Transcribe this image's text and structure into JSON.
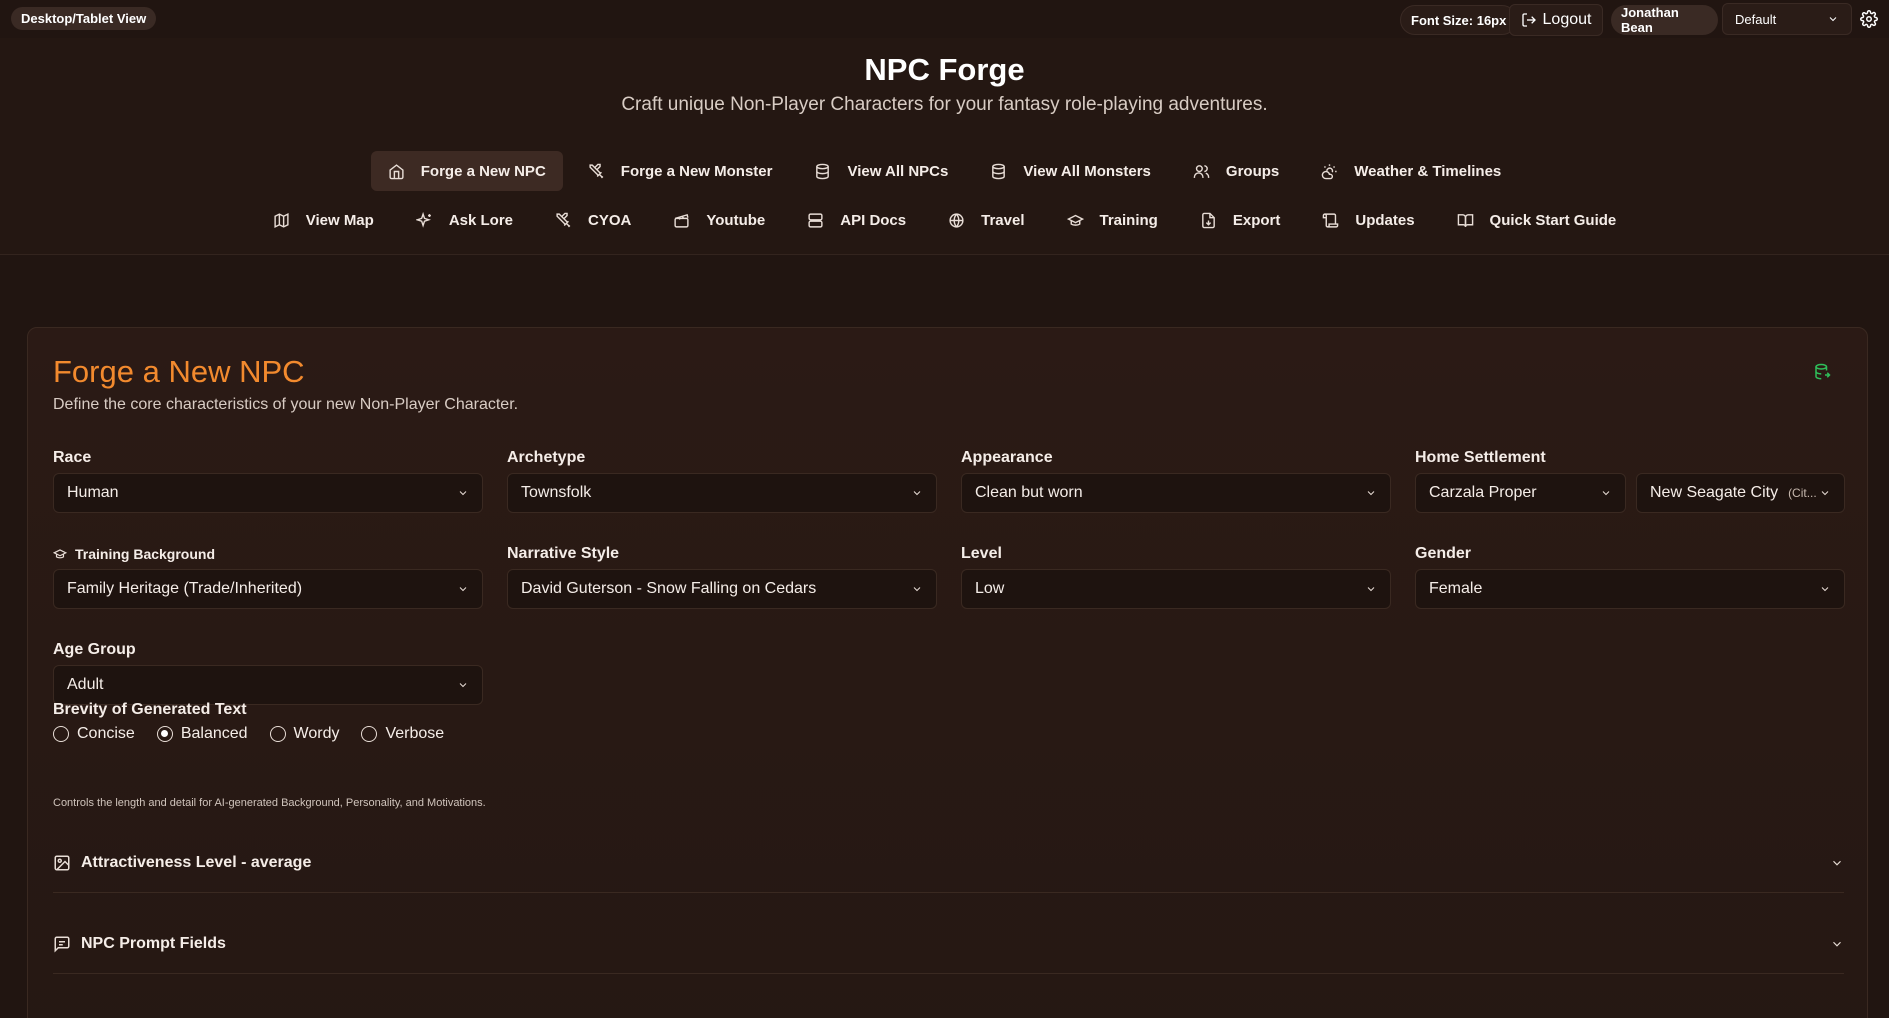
{
  "topbar": {
    "view_mode": "Desktop/Tablet View",
    "font_size": "Font Size: 16px",
    "logout": "Logout",
    "user": "Jonathan Bean",
    "theme": "Default"
  },
  "header": {
    "title": "NPC Forge",
    "subtitle": "Craft unique Non-Player Characters for your fantasy role-playing adventures."
  },
  "nav": {
    "row1": [
      "Forge a New NPC",
      "Forge a New Monster",
      "View All NPCs",
      "View All Monsters",
      "Groups",
      "Weather & Timelines"
    ],
    "row2": [
      "View Map",
      "Ask Lore",
      "CYOA",
      "Youtube",
      "API Docs",
      "Travel",
      "Training",
      "Export",
      "Updates",
      "Quick Start Guide"
    ]
  },
  "form": {
    "title": "Forge a New NPC",
    "subtitle": "Define the core characteristics of your new Non-Player Character.",
    "race": {
      "label": "Race",
      "value": "Human"
    },
    "archetype": {
      "label": "Archetype",
      "value": "Townsfolk"
    },
    "appearance": {
      "label": "Appearance",
      "value": "Clean but worn"
    },
    "settlement": {
      "label": "Home Settlement",
      "value": "Carzala Proper",
      "city": "New Seagate City",
      "city_suffix": "(Cit..."
    },
    "training": {
      "label": "Training Background",
      "value": "Family Heritage (Trade/Inherited)"
    },
    "narrative": {
      "label": "Narrative Style",
      "value": "David Guterson - Snow Falling on Cedars"
    },
    "level": {
      "label": "Level",
      "value": "Low"
    },
    "gender": {
      "label": "Gender",
      "value": "Female"
    },
    "age": {
      "label": "Age Group",
      "value": "Adult"
    },
    "brevity": {
      "label": "Brevity of Generated Text",
      "options": [
        "Concise",
        "Balanced",
        "Wordy",
        "Verbose"
      ],
      "selected": "Balanced",
      "hint": "Controls the length and detail for AI-generated Background, Personality, and Motivations."
    },
    "attractiveness": "Attractiveness Level - average",
    "prompt_fields": "NPC Prompt Fields"
  },
  "colors": {
    "accent": "#f28a2e",
    "background": "#211511",
    "db_icon": "#2fbf5a"
  }
}
